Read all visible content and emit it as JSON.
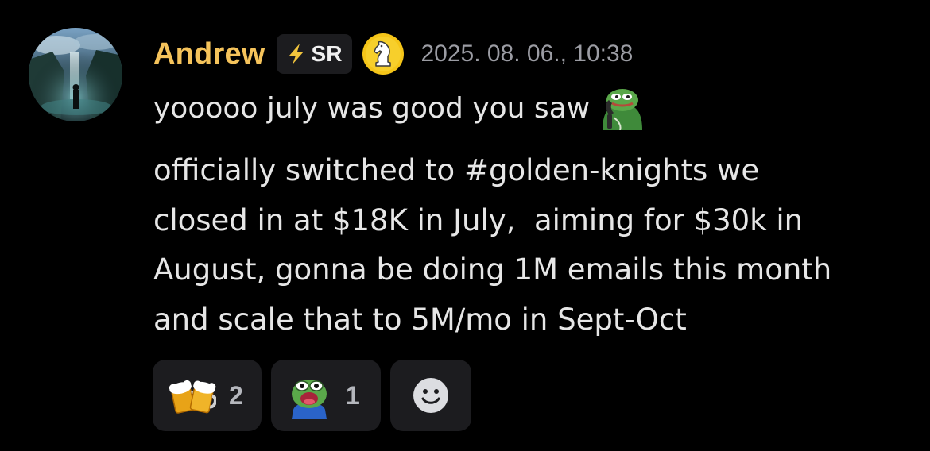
{
  "message": {
    "author": "Andrew",
    "tag_label": "SR",
    "timestamp": "2025. 08. 06., 10:38",
    "line1": "yooooo july was good you saw",
    "body_lines": [
      "officially switched to #golden-knights we",
      "closed in at $18K in July,  aiming for $30k in",
      "August, gonna be doing 1M emails this month",
      "and scale that to 5M/mo in Sept-Oct"
    ]
  },
  "reactions": [
    {
      "emoji": "beer-mugs",
      "count": "2"
    },
    {
      "emoji": "pepe-shocked",
      "count": "1"
    }
  ],
  "icons": {
    "tag_icon": "lightning-bolt-icon",
    "role_icon": "chess-knight-icon",
    "inline_emoji": "pepe-phone-emoji",
    "add_reaction": "smiley-add-reaction-icon"
  },
  "colors": {
    "background": "#000000",
    "username": "#f5c35b",
    "text": "#e6e6e6",
    "timestamp": "#9b9ca3",
    "chip": "#1c1c1f"
  }
}
